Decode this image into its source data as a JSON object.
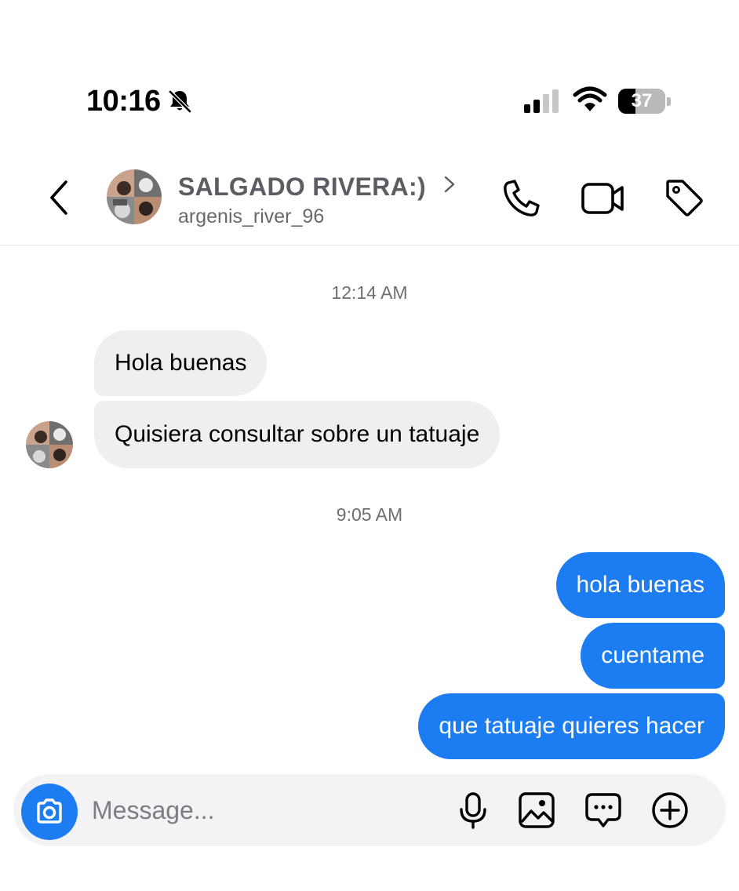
{
  "status_bar": {
    "time": "10:16",
    "battery_level": "37",
    "battery_fraction": 0.37,
    "icons": [
      "bell-slash-icon",
      "cellular-signal-icon",
      "wifi-icon",
      "battery-icon"
    ]
  },
  "header": {
    "contact_name": "SALGADO RIVERA:)",
    "contact_handle": "argenis_river_96",
    "icons": [
      "back-chevron-icon",
      "avatar",
      "chevron-right-icon",
      "phone-icon",
      "video-camera-icon",
      "tag-icon"
    ]
  },
  "conversation": {
    "groups": [
      {
        "timestamp": "12:14 AM",
        "messages": [
          {
            "direction": "incoming",
            "text": "Hola buenas"
          },
          {
            "direction": "incoming",
            "text": "Quisiera consultar sobre un tatuaje"
          }
        ]
      },
      {
        "timestamp": "9:05 AM",
        "messages": [
          {
            "direction": "outgoing",
            "text": "hola buenas"
          },
          {
            "direction": "outgoing",
            "text": "cuentame"
          },
          {
            "direction": "outgoing",
            "text": "que tatuaje quieres hacer"
          }
        ]
      }
    ]
  },
  "composer": {
    "placeholder": "Message...",
    "icons": [
      "camera-icon",
      "microphone-icon",
      "gallery-icon",
      "sticker-message-icon",
      "plus-circle-icon"
    ]
  },
  "colors": {
    "outgoing_bubble": "#1c7df2",
    "incoming_bubble": "#efeff1",
    "composer_bg": "#f3f3f5"
  }
}
